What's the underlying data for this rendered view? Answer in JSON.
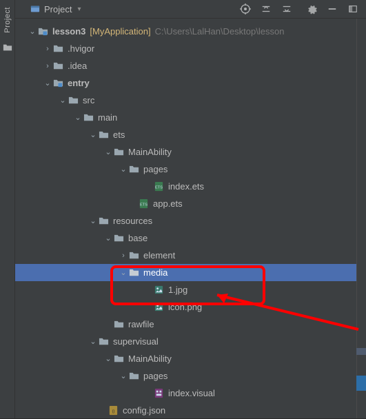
{
  "gutter": {
    "label": "Project"
  },
  "toolbar": {
    "title": "Project",
    "icons": [
      "target-icon",
      "expand-icon",
      "collapse-icon",
      "gear-icon",
      "minimize-icon",
      "panel-icon"
    ]
  },
  "root": {
    "name": "lesson3",
    "project": "[MyApplication]",
    "path": "C:\\Users\\LalHan\\Desktop\\lesson"
  },
  "tree": {
    "hvigor": ".hvigor",
    "idea": ".idea",
    "entry": "entry",
    "src": "src",
    "main": "main",
    "ets": "ets",
    "mainability": "MainAbility",
    "pages": "pages",
    "indexets": "index.ets",
    "appets": "app.ets",
    "resources": "resources",
    "base": "base",
    "element": "element",
    "media": "media",
    "jpg1": "1.jpg",
    "iconpng": "icon.png",
    "rawfile": "rawfile",
    "supervisual": "supervisual",
    "mainability2": "MainAbility",
    "pages2": "pages",
    "indexvisual": "index.visual",
    "configjson": "config.json"
  }
}
